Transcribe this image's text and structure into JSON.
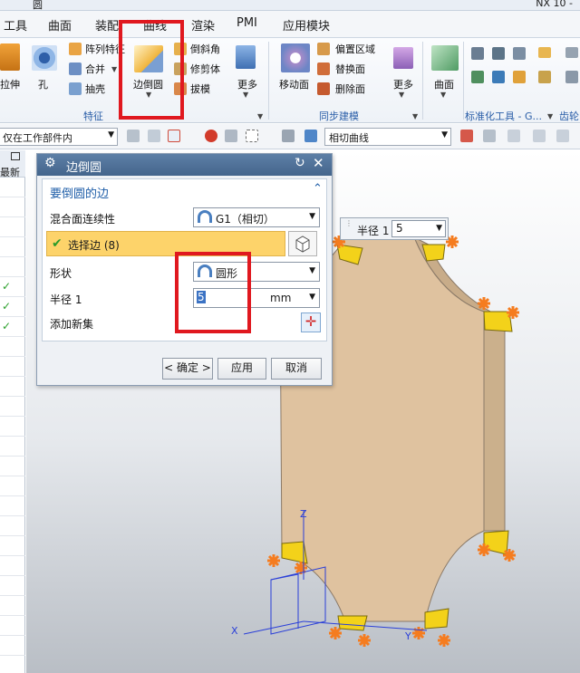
{
  "titlebar": {
    "left": "圆",
    "right": "NX 10 -"
  },
  "menu": {
    "tabs": [
      "工具",
      "曲面",
      "装配",
      "曲线",
      "渲染",
      "PMI",
      "应用模块"
    ]
  },
  "ribbon": {
    "feature_group": {
      "label": "特征",
      "extrude": "拉伸",
      "hole": "孔",
      "pattern": "阵列特征",
      "unite": "合并",
      "shell": "抽壳",
      "edge_blend": "边倒圆",
      "chamfer": "倒斜角",
      "trim_body": "修剪体",
      "draft": "拔模",
      "more": "更多"
    },
    "sync_group": {
      "label": "同步建模",
      "move_face": "移动面",
      "offset_region": "偏置区域",
      "replace_face": "替换面",
      "delete_face": "删除面",
      "more": "更多"
    },
    "surface_label": "曲面",
    "std_group_label": "标准化工具 - G...",
    "gear_label": "齿轮"
  },
  "toolbar": {
    "scope_filter": "仅在工作部件内",
    "curve_rule": "相切曲线"
  },
  "navigator": {
    "header_label": "最新"
  },
  "dialog": {
    "title": "边倒圆",
    "section_title": "要倒圆的边",
    "continuity_label": "混合面连续性",
    "continuity_value": "G1（相切）",
    "select_edge": "选择边 (8)",
    "shape_label": "形状",
    "shape_value": "圆形",
    "radius_label": "半径 1",
    "radius_value": "5",
    "radius_unit": "mm",
    "add_set_label": "添加新集",
    "ok_button": "< 确定 >",
    "apply_button": "应用",
    "cancel_button": "取消"
  },
  "radius_tip": {
    "label": "半径 1",
    "value": "5"
  },
  "axes": {
    "z": "Z",
    "x": "X",
    "y": "Y"
  },
  "colors": {
    "highlight_red": "#e0181f",
    "part_tan": "#dfc29f",
    "blend_yellow": "#f3d21a",
    "selected_row": "#fdd36a",
    "handle_orange": "#f57c1f"
  }
}
